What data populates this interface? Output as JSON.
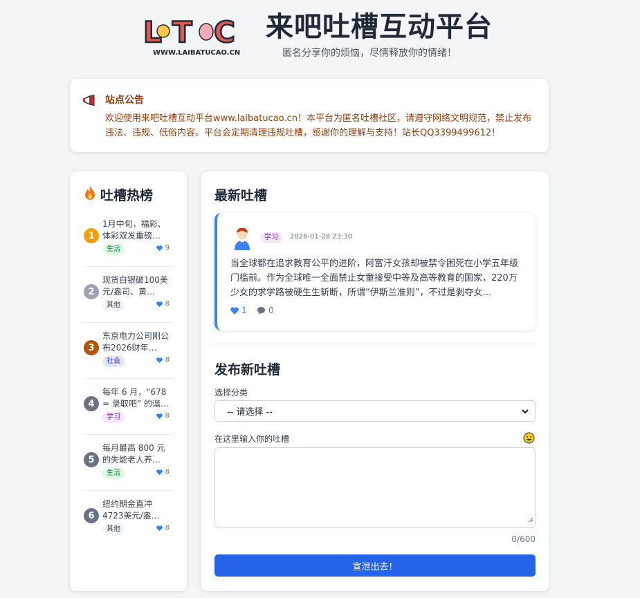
{
  "header": {
    "logo_text": "LBTC",
    "logo_url_text": "WWW.LAIBATUCAO.CN",
    "title": "来吧吐槽互动平台",
    "subtitle": "匿名分享你的烦恼，尽情释放你的情绪！"
  },
  "notice": {
    "icon": "megaphone-icon",
    "title": "站点公告",
    "text": "欢迎使用来吧吐槽互动平台www.laibatucao.cn！本平台为匿名吐槽社区，请遵守网络文明规范，禁止发布违法、违规、低俗内容。平台会定期清理违规吐槽，感谢你的理解与支持！站长QQ3399499612！"
  },
  "hot": {
    "icon": "fire-icon",
    "title": "吐槽热榜",
    "items": [
      {
        "rank": "1",
        "text": "1月中旬，福彩、体彩双发重磅…",
        "tag": "生活",
        "likes": "9"
      },
      {
        "rank": "2",
        "text": "现货白银破100美元/盎司、黄…",
        "tag": "其他",
        "likes": "8"
      },
      {
        "rank": "3",
        "text": "东京电力公司刚公布2026财年…",
        "tag": "社会",
        "likes": "8"
      },
      {
        "rank": "4",
        "text": "每年 6 月，“678 = 录取吧” 的谐…",
        "tag": "学习",
        "likes": "8"
      },
      {
        "rank": "5",
        "text": "每月最高 800 元的失能老人养…",
        "tag": "生活",
        "likes": "8"
      },
      {
        "rank": "6",
        "text": "纽约期金直冲4723美元/盎…",
        "tag": "其他",
        "likes": "8"
      }
    ]
  },
  "latest": {
    "title": "最新吐槽",
    "post": {
      "tag": "学习",
      "time": "2026-01-28 23:30",
      "text": "当全球都在追求教育公平的进阶，阿富汗女孩却被禁令困死在小学五年级门槛前。作为全球唯一全面禁止女童接受中等及高等教育的国家，220万少女的求学路被硬生生斩断，所谓“伊斯兰准则”，不过是剥夺女…",
      "likes": "1",
      "comments": "0"
    }
  },
  "compose": {
    "title": "发布新吐槽",
    "category_label": "选择分类",
    "category_value": "-- 请选择 --",
    "content_label": "在这里输入你的吐槽",
    "counter": "0/600",
    "submit_label": "宣泄出去！"
  },
  "colors": {
    "primary": "#2563eb",
    "notice_text": "#92400e",
    "rank_1": "#f59e0b",
    "rank_2": "#9ca3af",
    "rank_3": "#b45309",
    "rank_other": "#6b7280"
  }
}
